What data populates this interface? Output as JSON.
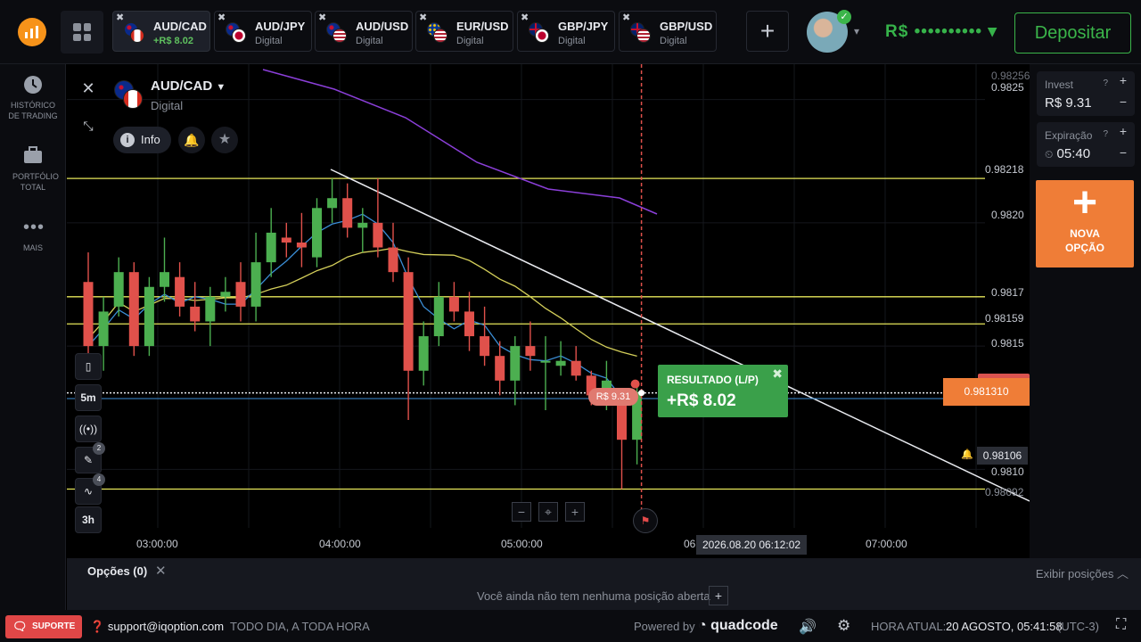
{
  "logo": {
    "symbol": "iq-option-logo"
  },
  "tabs": [
    {
      "name": "AUD/CAD",
      "sub": "+R$ 8.02",
      "flag_a": "au",
      "flag_b": "ca",
      "active": true
    },
    {
      "name": "AUD/JPY",
      "sub": "Digital",
      "flag_a": "au",
      "flag_b": "jp"
    },
    {
      "name": "AUD/USD",
      "sub": "Digital",
      "flag_a": "au",
      "flag_b": "us"
    },
    {
      "name": "EUR/USD",
      "sub": "Digital",
      "flag_a": "us-eu",
      "flag_b": "us"
    },
    {
      "name": "GBP/JPY",
      "sub": "Digital",
      "flag_a": "gb",
      "flag_b": "jp"
    },
    {
      "name": "GBP/USD",
      "sub": "Digital",
      "flag_a": "gb",
      "flag_b": "us"
    }
  ],
  "header": {
    "balance": "R$ •••••••••• ▾",
    "deposit_label": "Depositar"
  },
  "sidebar": {
    "items": [
      {
        "label": "HISTÓRICO DE TRADING",
        "icon": "clock-icon"
      },
      {
        "label": "PORTFÓLIO TOTAL",
        "icon": "briefcase-icon"
      },
      {
        "label": "MAIS",
        "icon": "more-icon"
      }
    ]
  },
  "asset": {
    "name": "AUD/CAD",
    "type": "Digital",
    "info_label": "Info"
  },
  "invest": {
    "label": "Invest",
    "value": "R$ 9.31"
  },
  "expiry": {
    "label": "Expiração",
    "value": "05:40"
  },
  "new_option": {
    "line1": "NOVA",
    "line2": "OPÇÃO"
  },
  "tools": {
    "timeframe": "5m",
    "range": "3h",
    "draw_badge": "2",
    "indicators_badge": "4"
  },
  "result": {
    "label": "RESULTADO (L/P)",
    "value": "+R$ 8.02"
  },
  "position_badge": "R$ 9.31",
  "price_axis": [
    "0.98256",
    "0.9825",
    "0.98218",
    "0.9820",
    "0.9817",
    "0.98159",
    "0.9815",
    "0.9810",
    "0.98092"
  ],
  "current_price": "0.981310",
  "alert_price": "0.98106",
  "time_axis": [
    "03:00:00",
    "04:00:00",
    "05:00:00",
    "06",
    "07:00:00"
  ],
  "crosshair_time": "2026.08.20 06:12:02",
  "options_panel": {
    "title": "Opções (0)",
    "empty_text": "Você ainda não tem nenhuma posição aberta",
    "show_positions": "Exibir posições"
  },
  "footer": {
    "support_label": "SUPORTE",
    "email": "support@iqoption.com",
    "hours": "TODO DIA, A TODA HORA",
    "powered_by": "Powered by",
    "brand": "quadcode",
    "clock_label": "HORA ATUAL:",
    "clock_value": "20 AGOSTO, 05:41:58",
    "timezone": "(UTC-3)"
  },
  "chart_data": {
    "type": "candlestick",
    "x": [
      "02:40",
      "02:45",
      "02:50",
      "02:55",
      "03:00",
      "03:05",
      "03:10",
      "03:15",
      "03:20",
      "03:25",
      "03:30",
      "03:35",
      "03:40",
      "03:45",
      "03:50",
      "03:55",
      "04:00",
      "04:05",
      "04:10",
      "04:15",
      "04:20",
      "04:25",
      "04:30",
      "04:35",
      "04:40",
      "04:45",
      "04:50",
      "04:55",
      "05:00",
      "05:05",
      "05:10",
      "05:15",
      "05:20",
      "05:25",
      "05:30",
      "05:35",
      "05:40"
    ],
    "candles": [
      {
        "o": 0.98176,
        "c": 0.9815,
        "h": 0.98188,
        "l": 0.98146
      },
      {
        "o": 0.9815,
        "c": 0.98164,
        "h": 0.9817,
        "l": 0.9814
      },
      {
        "o": 0.98166,
        "c": 0.9818,
        "h": 0.98186,
        "l": 0.98162
      },
      {
        "o": 0.9818,
        "c": 0.9815,
        "h": 0.98184,
        "l": 0.98146
      },
      {
        "o": 0.9815,
        "c": 0.98174,
        "h": 0.98178,
        "l": 0.98146
      },
      {
        "o": 0.98174,
        "c": 0.9818,
        "h": 0.98194,
        "l": 0.98168
      },
      {
        "o": 0.98178,
        "c": 0.98166,
        "h": 0.98184,
        "l": 0.98162
      },
      {
        "o": 0.98166,
        "c": 0.9816,
        "h": 0.98176,
        "l": 0.98156
      },
      {
        "o": 0.9816,
        "c": 0.9817,
        "h": 0.98174,
        "l": 0.9815
      },
      {
        "o": 0.9817,
        "c": 0.98172,
        "h": 0.98178,
        "l": 0.98164
      },
      {
        "o": 0.98176,
        "c": 0.98166,
        "h": 0.98184,
        "l": 0.9816
      },
      {
        "o": 0.98166,
        "c": 0.98184,
        "h": 0.98196,
        "l": 0.9816
      },
      {
        "o": 0.98184,
        "c": 0.98196,
        "h": 0.98206,
        "l": 0.98178
      },
      {
        "o": 0.98194,
        "c": 0.98192,
        "h": 0.982,
        "l": 0.98186
      },
      {
        "o": 0.98192,
        "c": 0.9819,
        "h": 0.98204,
        "l": 0.98182
      },
      {
        "o": 0.98186,
        "c": 0.98206,
        "h": 0.9821,
        "l": 0.98182
      },
      {
        "o": 0.98206,
        "c": 0.9821,
        "h": 0.98218,
        "l": 0.982
      },
      {
        "o": 0.9821,
        "c": 0.98198,
        "h": 0.98216,
        "l": 0.98194
      },
      {
        "o": 0.98198,
        "c": 0.982,
        "h": 0.98206,
        "l": 0.98188
      },
      {
        "o": 0.982,
        "c": 0.9819,
        "h": 0.98218,
        "l": 0.98186
      },
      {
        "o": 0.9819,
        "c": 0.9818,
        "h": 0.982,
        "l": 0.98176
      },
      {
        "o": 0.9818,
        "c": 0.9814,
        "h": 0.98186,
        "l": 0.9812
      },
      {
        "o": 0.9814,
        "c": 0.98154,
        "h": 0.9816,
        "l": 0.98134
      },
      {
        "o": 0.98154,
        "c": 0.9817,
        "h": 0.98176,
        "l": 0.9815
      },
      {
        "o": 0.9817,
        "c": 0.98164,
        "h": 0.98176,
        "l": 0.9816
      },
      {
        "o": 0.98164,
        "c": 0.98154,
        "h": 0.98172,
        "l": 0.98148
      },
      {
        "o": 0.98154,
        "c": 0.98146,
        "h": 0.98166,
        "l": 0.98142
      },
      {
        "o": 0.98146,
        "c": 0.98136,
        "h": 0.98152,
        "l": 0.9813
      },
      {
        "o": 0.98136,
        "c": 0.9815,
        "h": 0.98154,
        "l": 0.98126
      },
      {
        "o": 0.9815,
        "c": 0.98146,
        "h": 0.9816,
        "l": 0.9814
      },
      {
        "o": 0.98144,
        "c": 0.98144,
        "h": 0.98154,
        "l": 0.98124
      },
      {
        "o": 0.98142,
        "c": 0.98144,
        "h": 0.98152,
        "l": 0.98138
      },
      {
        "o": 0.98144,
        "c": 0.98138,
        "h": 0.9815,
        "l": 0.98136
      },
      {
        "o": 0.98138,
        "c": 0.9813,
        "h": 0.9814,
        "l": 0.98126
      },
      {
        "o": 0.9813,
        "c": 0.98136,
        "h": 0.98144,
        "l": 0.98124
      },
      {
        "o": 0.98126,
        "c": 0.98112,
        "h": 0.98132,
        "l": 0.98092
      },
      {
        "o": 0.98112,
        "c": 0.98131,
        "h": 0.98136,
        "l": 0.98102
      }
    ],
    "horizontal_levels": [
      0.98218,
      0.9817,
      0.98159,
      0.98092
    ],
    "ylim": [
      0.9809,
      0.9826
    ],
    "grid": true,
    "colors": {
      "up": "#4caf50",
      "down": "#e0514b",
      "ma_fast": "#3b8ed6",
      "ma_slow": "#d4cf5a",
      "ma_long": "#8b3fd9",
      "level": "#e6e65a"
    }
  }
}
